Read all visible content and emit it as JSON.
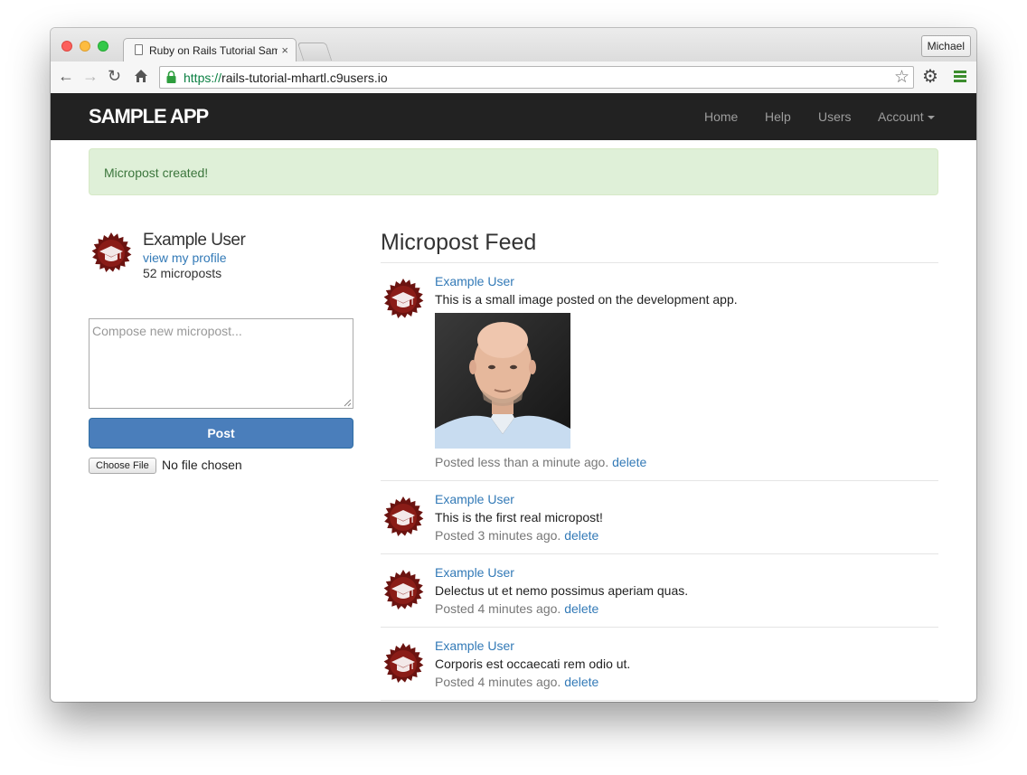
{
  "browser": {
    "tab_title": "Ruby on Rails Tutorial Sample App",
    "tab_close": "×",
    "profile_name": "Michael",
    "url_scheme": "https://",
    "url_host": "rails-tutorial-mhartl.c9users.io",
    "icons": [
      "back-icon",
      "forward-icon",
      "reload-icon",
      "home-icon",
      "lock-icon",
      "bookmark-star-icon",
      "settings-gear-icon",
      "menu-icon"
    ]
  },
  "navbar": {
    "logo": "sample app",
    "links": [
      "Home",
      "Help",
      "Users",
      "Account"
    ]
  },
  "alert": {
    "message": "Micropost created!",
    "color": "#dff0d8"
  },
  "sidebar": {
    "user_name": "Example User",
    "profile_link": "view my profile",
    "micropost_count": "52 microposts",
    "compose_placeholder": "Compose new micropost...",
    "post_button": "Post",
    "choose_file": "Choose File",
    "file_status": "No file chosen"
  },
  "feed": {
    "title": "Micropost Feed",
    "delete_label": "delete",
    "posts": [
      {
        "user": "Example User",
        "content": "This is a small image posted on the development app.",
        "time": "Posted less than a minute ago.",
        "has_image": true
      },
      {
        "user": "Example User",
        "content": "This is the first real micropost!",
        "time": "Posted 3 minutes ago."
      },
      {
        "user": "Example User",
        "content": "Delectus ut et nemo possimus aperiam quas.",
        "time": "Posted 4 minutes ago."
      },
      {
        "user": "Example User",
        "content": "Corporis est occaecati rem odio ut.",
        "time": "Posted 4 minutes ago."
      }
    ]
  },
  "colors": {
    "navbar": "#222222",
    "link": "#337ab7",
    "button": "#4a7ebb",
    "avatar": "#6b1310"
  }
}
